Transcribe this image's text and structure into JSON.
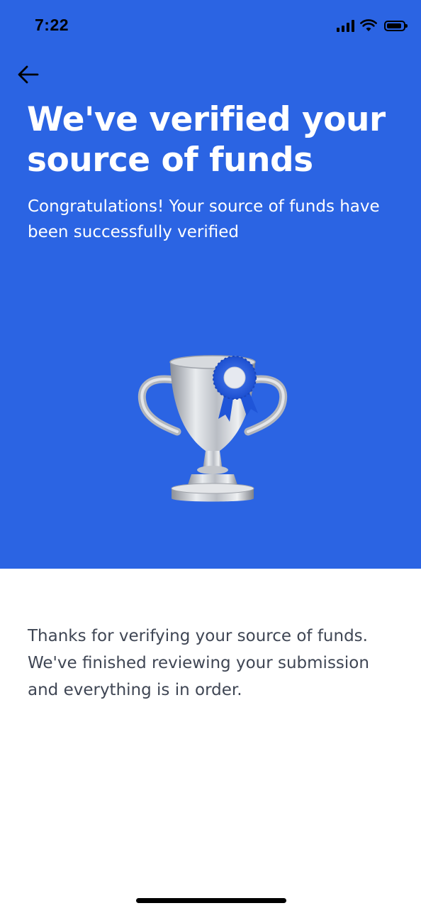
{
  "status_bar": {
    "time": "7:22",
    "icons": [
      "signal-icon",
      "wifi-icon",
      "battery-icon"
    ]
  },
  "header": {
    "back_icon": "arrow-left-icon",
    "title": "We've verified your source of funds",
    "subtitle": "Congratulations! Your source of funds have been successfully verified"
  },
  "illustration": {
    "icon": "trophy-icon"
  },
  "content": {
    "message": "Thanks for verifying your source of funds. We've finished reviewing your submission and everything is in order."
  },
  "colors": {
    "hero_background": "#2b64e3",
    "hero_text": "#ffffff",
    "body_text": "#3f4654",
    "page_background": "#ffffff"
  }
}
